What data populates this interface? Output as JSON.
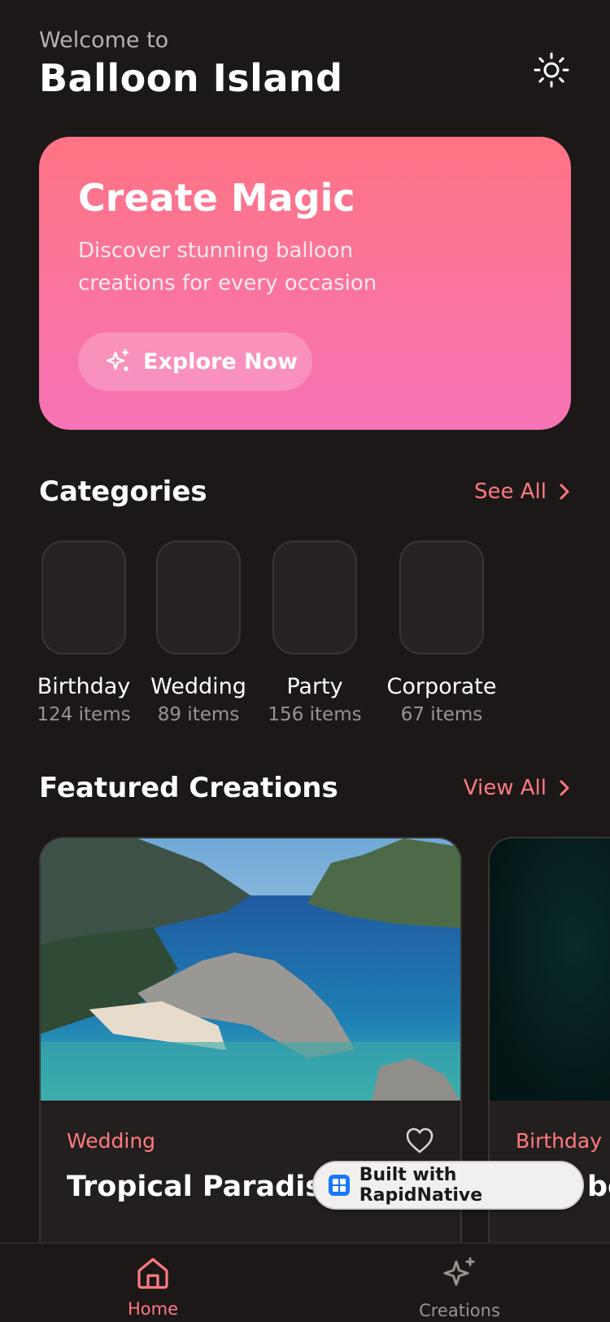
{
  "header": {
    "welcome": "Welcome to",
    "title": "Balloon Island",
    "theme_icon": "sun-icon"
  },
  "hero": {
    "title": "Create Magic",
    "subtitle": "Discover stunning balloon creations for every occasion",
    "button_label": "Explore Now",
    "button_icon": "sparkles-icon",
    "gradient": [
      "#fe7483",
      "#f673b6"
    ]
  },
  "categories": {
    "title": "Categories",
    "link": "See All",
    "items": [
      {
        "name": "Birthday",
        "count": "124 items"
      },
      {
        "name": "Wedding",
        "count": "89 items"
      },
      {
        "name": "Party",
        "count": "156 items"
      },
      {
        "name": "Corporate",
        "count": "67 items"
      }
    ]
  },
  "featured": {
    "title": "Featured Creations",
    "link": "View All",
    "cards": [
      {
        "tag": "Wedding",
        "name": "Tropical Paradise"
      },
      {
        "tag": "Birthday",
        "name": "bo"
      }
    ]
  },
  "badge": {
    "label": "Built with RapidNative"
  },
  "tabs": [
    {
      "label": "Home",
      "icon": "home-icon",
      "active": true
    },
    {
      "label": "Creations",
      "icon": "sparkles-icon",
      "active": false
    }
  ],
  "colors": {
    "accent": "#ff7a82",
    "background": "#1c1817",
    "card": "#231f1e"
  }
}
